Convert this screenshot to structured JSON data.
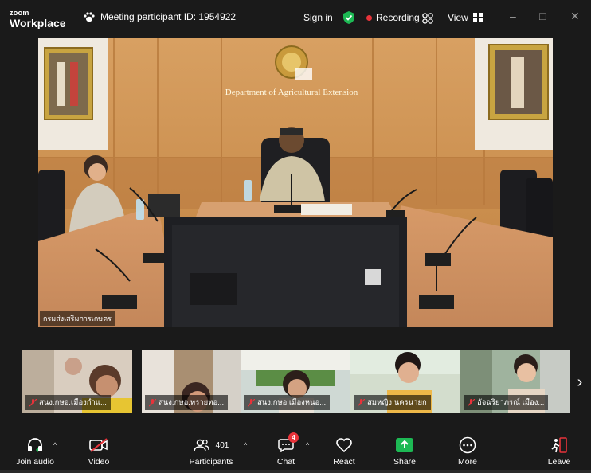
{
  "app": {
    "logo_line1": "zoom",
    "logo_line2": "Workplace"
  },
  "titlebar": {
    "meeting_id": "Meeting participant ID: 1954922",
    "signin": "Sign in",
    "recording": "Recording",
    "view": "View",
    "minimize": "–",
    "maximize": "□",
    "close": "✕"
  },
  "main_video": {
    "label": "กรมส่งเสริมการเกษตร",
    "sign_text": "Department of Agricultural Extension"
  },
  "participants": [
    {
      "name": "สนง.กษอ.เมืองกำแ..."
    },
    {
      "name": "สนง.กษอ.ทรายทอ..."
    },
    {
      "name": "สนง.กษอ.เมืองหนอ..."
    },
    {
      "name": "สมหญิง นครนายก"
    },
    {
      "name": "อัจฉริยาภรณ์ เมือง..."
    }
  ],
  "toolbar": {
    "join_audio": "Join audio",
    "video": "Video",
    "participants": "Participants",
    "participants_count": "401",
    "chat": "Chat",
    "chat_badge": "4",
    "react": "React",
    "share": "Share",
    "more": "More",
    "leave": "Leave"
  },
  "colors": {
    "accent_green": "#1db954",
    "recording_red": "#e8333a",
    "bg": "#1a1a1a"
  },
  "icons": [
    "paw-icon",
    "shield-check-icon",
    "grid-icon",
    "headphones-icon",
    "video-off-icon",
    "participants-icon",
    "chat-icon",
    "heart-icon",
    "share-icon",
    "more-icon",
    "leave-icon",
    "mic-off-icon",
    "chevron-right-icon"
  ]
}
